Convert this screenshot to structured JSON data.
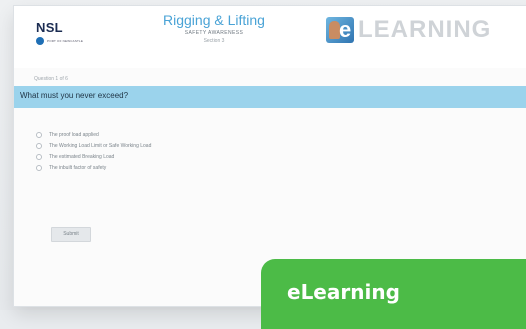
{
  "header": {
    "org_name": "NSL",
    "org_subtext": "PORT OF NEWCASTLE",
    "course_title": "Rigging & Lifting",
    "course_subtitle": "SAFETY AWARENESS",
    "course_section": "Section 3",
    "brand_letter": "e",
    "brand_text": "LEARNING"
  },
  "quiz": {
    "question_number": "Question 1 of 6",
    "question": "What must you never exceed?",
    "options": [
      "The proof load applied",
      "The Working Load Limit or Safe Working Load",
      "The estimated Breaking Load",
      "The inbuilt factor of safety"
    ],
    "submit_label": "Submit"
  },
  "badge": {
    "label": "eLearning"
  },
  "colors": {
    "question_bar": "#9bd3ec",
    "badge": "#4cbb47",
    "course_title": "#4aa3d6"
  }
}
